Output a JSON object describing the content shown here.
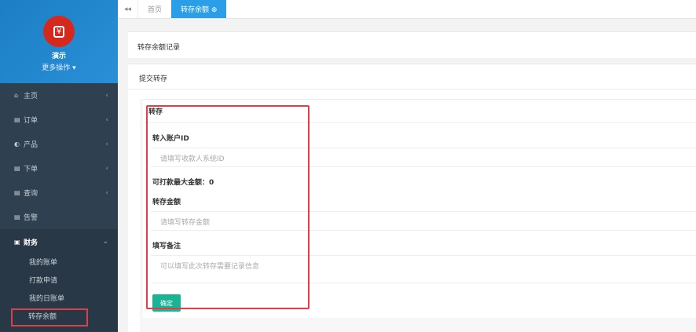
{
  "sidebar": {
    "user_name": "演示",
    "more_actions": "更多操作 ▾",
    "items": [
      {
        "label": "主页",
        "icon": "home-icon",
        "glyph": "⌂"
      },
      {
        "label": "订单",
        "icon": "file-icon",
        "glyph": "▤"
      },
      {
        "label": "产品",
        "icon": "cube-icon",
        "glyph": "◐"
      },
      {
        "label": "下单",
        "icon": "file-icon",
        "glyph": "▤"
      },
      {
        "label": "查询",
        "icon": "file-icon",
        "glyph": "▤"
      },
      {
        "label": "告警",
        "icon": "file-icon",
        "glyph": "▤"
      }
    ],
    "finance": {
      "label": "财务",
      "glyph": "▣",
      "children": [
        "我的账单",
        "打款申请",
        "我的日账单",
        "转存余额"
      ]
    }
  },
  "tabs": {
    "home": "首页",
    "active": "转存余额 ⊗"
  },
  "main": {
    "records_title": "转存余额记录",
    "submit_title": "提交转存",
    "form": {
      "title": "转存",
      "account_label": "转入账户ID",
      "account_placeholder": "请填写收款人系统ID",
      "max_amount": "可打款最大金额：0",
      "amount_label": "转存金额",
      "amount_placeholder": "请填写转存金额",
      "note_label": "填写备注",
      "note_placeholder": "可以填写此次转存需要记录信息",
      "submit": "确定"
    }
  },
  "colors": {
    "accent": "#2a9ee6",
    "sidebar": "#2f4050",
    "button": "#1ab394",
    "highlight": "#d9414a"
  }
}
